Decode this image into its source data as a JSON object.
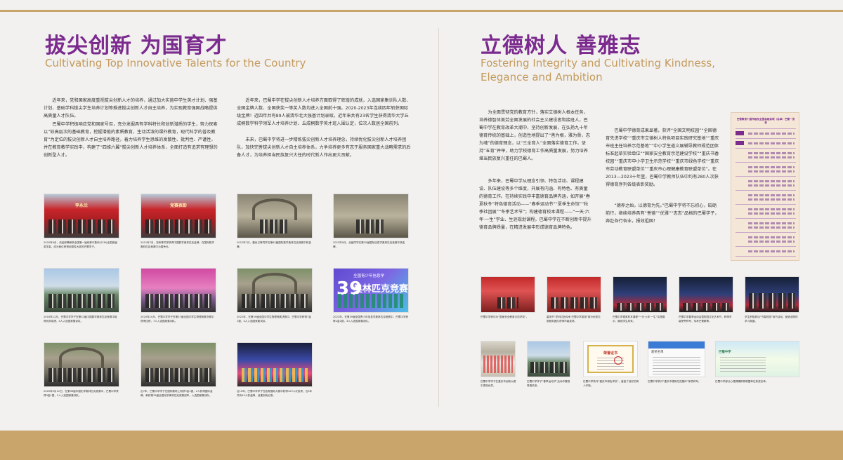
{
  "left": {
    "title_cn": "拔尖创新 为国育才",
    "title_en": "Cultivating Top Innovative Talents for the Country",
    "para1": "近年来，党和国家高度重视拔尖创新人才的培养，通过加大实施中学生英才计划、强基计划、基础学科拔尖学生培养计划等推进拔尖创新人才自主培养，为实现教育强国战略提供高质量人才队伍。",
    "para2": "巴蜀中学积极响应党和国家号召，充分发掘具有学科特长和创新潜质的学生，努力探索以“较高层次的基础教育，挖掘潜能的素质教育，生动活泼的课外教育，现代科学的普及教育”为定位的拔尖创新人才自主培养路径，着力培养学生思维的发散性、批判性、严谨性，并在教育教学实践中，构建了“四维六翼”拔尖创新人才培养体系，全面打造有追求有理想的创新型人才。",
    "para3": "近年来，巴蜀中学在拔尖创新人才培养方面取得了辉煌的成就，入选国家集训队人数、全国金牌人数、全国获奖一等奖人数均进入全国前十强。2020-2023年连续四年斩获国际级金牌！近四年共有89人被清华北大强基计划录取。近年来共有23名学生获得清华大学丘成桐数学科学领军人才培养计划、丘成桐数学英才班入围认定，位次人数居全国前列。",
    "para4": "未来，巴蜀中学将进一步精炼拔尖创新人才培养理念，持续优化拔尖创新人才培养团队，加快完善拔尖创新人才自主培养体系，力争培养更多有志于服务国家重大战略需求的后备人才，为培养担当民族复兴大任的时代新人作出更大贡献。",
    "banner1": "李永兰",
    "banner2": "竞赛表彰",
    "poster_sub": "全国青少年信息学",
    "poster_num": "39",
    "poster_text": "奥林匹克竞赛",
    "captions": [
      "2020年9月，央金郎腾荣获全国第一届纯粹中数科(SCM)全国首届奖学金，成为首位获得全国性大奖的巴蜀学子。",
      "2021年7月，张昕等同学获得中国数学奥林匹克金牌，在国际数学奥林匹克竞赛中为国争光。",
      "2022年7月，董尚卫等同学在第63届国际数学奥林匹克竞赛中获金牌。",
      "2023年9月，余宸同学在第35届国际信息学奥林匹克竞赛中获金牌。",
      "2016年12月，巴蜀中学学子在第32届中国数学奥林匹克竞赛中取得优异成绩，4人入选国家集训队。",
      "2020年10月，巴蜀中学学子在第37届全国中学生物理竞赛决赛中获得佳绩，7人入选国家集训队。",
      "2022年，在第39届全国中学生物理竞赛决赛中，巴蜀中学获得7金1银，4人入选国家集训队。",
      "2022年，在第39届全国青少年信息学奥林匹克竞赛中，巴蜀中学获得2金2银，3人入选国家集训队。",
      "2020年9月12日，在第36届中国化学奥林匹克竞赛中，巴蜀中学获得3金1银，2人入选国家集训队。",
      "近7年，巴蜀中学学子在国际赛场上斩获9金1银，2人获得国际金牌，荣获第33届全国化学奥林匹克竞赛冠军，入选国家集训队。",
      "近10年，巴蜀中学学子在各类国际大赛中获得129人次奖项，近3年共有49人获金牌，创重庆新纪录。"
    ]
  },
  "right": {
    "title_cn": "立德树人 善雅志",
    "title_en_1": "Fostering Integrity and Cultivating Kindness,",
    "title_en_2": "Elegance and Ambition",
    "para1": "为全面贯彻党的教育方针，落实立德树人根本任务，培养德智体美劳全面发展的社会主义建设者和接班人，巴蜀中学在教育改革大潮中，坚持创新发展，在弘扬九十年德育传统的基础上，创造性地提出了“善为根，雅为骨，志为魂”的德育理念，以“三全育人”全面落实德育工作，坚持“五育”并举，助力学校德育工作高质量发展，努力培养堪当民族复兴重任的巴蜀人。",
    "para2": "多年来，巴蜀中学从理念引领、特色活动、课程建设、队伍建设等多个维度，开展有内涵、有特色、有质量的德育工作。在持续实践中丰富德育品牌内涵，如开展“春夏秋冬”特色德育活动——“春季运动节”“夏季生命馆”“秋季社团展”“冬季艺术节”；构建德育校本课程——“一天·六年·一生”学业、生涯规划课程。巴蜀中学在不断创新中提升德育品牌质量，在精进发展中形成德育品牌特色。",
    "para3": "巴蜀中学德育成果显著，获评“全国文明校园”“全国德育先进学校”“重庆市立德树人特色项目实践研究基地”“重庆市班主任培养示范基地”“中小学生道义展辅导教师规范团体标准起草实验单位”“国家安全教育示范建设学校”“重庆书香校园”“重庆市中小学卫生示范学校”“重庆市绿色学校”“重庆市劳动教育联盟单位”“重庆市心理健康教育联盟单位”。在2013—2023十年里，巴蜀中学教师队伍中约有280人次获得德育序列各级表彰奖励。",
    "para4": "“德养之始，以德育为先。”巴蜀中学将不忘初心，砥砺前行，继续培养具有“善德”“优雅”“志志”品格的巴蜀学子，奔赴各行各业，报效祖国！",
    "panel_title": "巴蜀教育十届市级及全国各级奖项（名单）巴蜀一览表",
    "cert_title": "荣誉证书",
    "doc_title": "获奖名单",
    "poster_title": "巴蜀中学",
    "captions": [
      "巴蜀中学获评为“国家安全教育示范学校”。",
      "重庆市“学科红色传承 巴蜀中学英雄”部分优秀志愿服务团队获得市级奖项。",
      "巴蜀中学德育校本课程“一天·六年·一生”实践展示，展现学生风采。",
      "巴蜀中学春季运动会暨校园文化艺术节，获得市级荣誉称号，传承巴蜀精神。",
      "学生积极参加“书香校园”读书活动，营造浓厚的学习氛围。",
      "巴蜀中学学子在重庆市创新大赛中表现优异。",
      "巴蜀中学学子“春季运动节”活动中展现青春风采。",
      "巴蜀中学获评“重庆市绿色学校”，营造了良好的育人环境。",
      "巴蜀中学获评“重庆市德育先进集体”荣誉称号。",
      "巴蜀中学学子获得市级奖项，展现学生风采。",
      "巴蜀中学部分心理健康教育联盟单位获奖名单。"
    ]
  },
  "colors": {
    "accent_purple": "#7b2a8e",
    "accent_gold": "#c49a5c",
    "bar_gold": "#c9a56c"
  }
}
